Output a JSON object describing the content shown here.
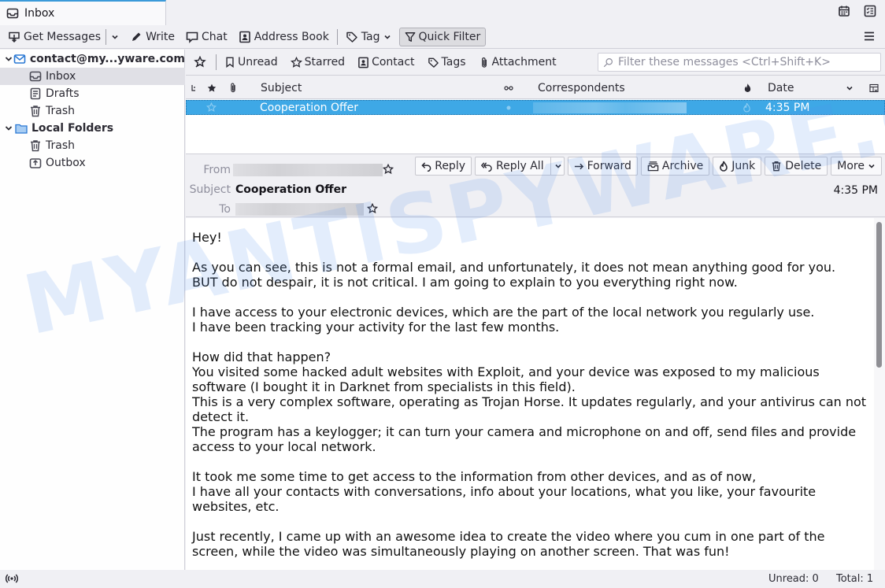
{
  "tabs": [
    {
      "label": "Inbox",
      "icon": "inbox-icon"
    }
  ],
  "tabbar_icons": [
    "calendar-icon",
    "tasks-icon"
  ],
  "toolbar": {
    "get_messages": "Get Messages",
    "write": "Write",
    "chat": "Chat",
    "address_book": "Address Book",
    "tag": "Tag",
    "quick_filter": "Quick Filter"
  },
  "folders": {
    "account": "contact@my...yware.com",
    "account_items": [
      "Inbox",
      "Drafts",
      "Trash"
    ],
    "local": "Local Folders",
    "local_items": [
      "Trash",
      "Outbox"
    ],
    "selected": "Inbox"
  },
  "quick_filter_bar": {
    "unread": "Unread",
    "starred": "Starred",
    "contact": "Contact",
    "tags": "Tags",
    "attachment": "Attachment",
    "search_placeholder": "Filter these messages <Ctrl+Shift+K>"
  },
  "thread_columns": {
    "subject": "Subject",
    "correspondents": "Correspondents",
    "date": "Date"
  },
  "messages": [
    {
      "subject": "Cooperation Offer",
      "correspondent": "",
      "date": "4:35 PM",
      "selected": true
    }
  ],
  "message_header": {
    "from_label": "From",
    "subject_label": "Subject",
    "to_label": "To",
    "subject": "Cooperation Offer",
    "date": "4:35 PM",
    "buttons": {
      "reply": "Reply",
      "reply_all": "Reply All",
      "forward": "Forward",
      "archive": "Archive",
      "junk": "Junk",
      "delete": "Delete",
      "more": "More"
    }
  },
  "message_body": "Hey!\n\nAs you can see, this is not a formal email, and unfortunately, it does not mean anything good for you.\nBUT do not despair, it is not critical. I am going to explain to you everything right now.\n\nI have access to your electronic devices, which are the part of the local network you regularly use.\nI have been tracking your activity for the last few months.\n\nHow did that happen?\nYou visited some hacked adult websites with Exploit, and your device was exposed to my malicious\nsoftware (I bought it in Darknet from specialists in this field).\nThis is a very complex software, operating as Trojan Horse. It updates regularly, and your antivirus can not\ndetect it.\nThe program has a keylogger; it can turn your camera and microphone on and off, send files and provide\naccess to your local network.\n\nIt took me some time to get access to the information from other devices, and as of now,\nI have all your contacts with conversations, info about your locations, what you like, your favourite\nwebsites, etc.\n\nJust recently, I came up with an awesome idea to create the video where you cum in one part of the\nscreen, while the video was simultaneously playing on another screen. That was fun!",
  "watermark": "MYANTISPYWARE.COM",
  "status": {
    "unread": "Unread: 0",
    "total": "Total: 1"
  },
  "colors": {
    "accent": "#3b9ad9",
    "selection": "#3ea8e6"
  }
}
